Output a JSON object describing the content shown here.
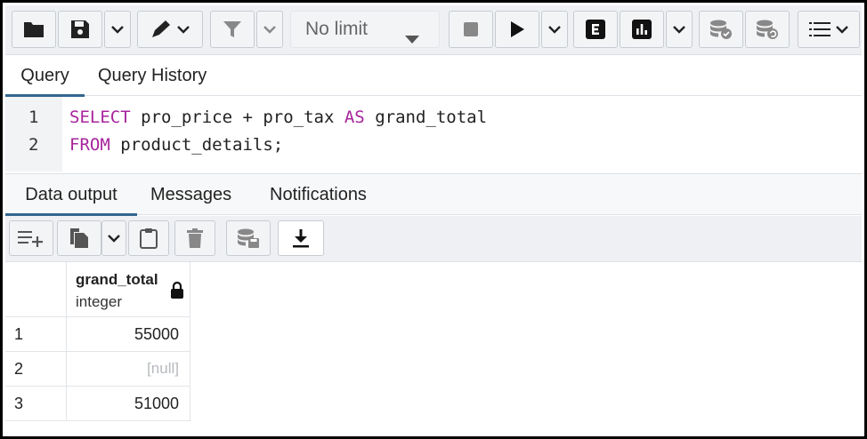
{
  "toolbar": {
    "open_file_icon": "folder-icon",
    "save_icon": "floppy-disk-icon",
    "edit_icon": "pencil-icon",
    "filter_icon": "funnel-icon",
    "limit_value": "No limit",
    "stop_icon": "stop-icon",
    "execute_icon": "play-icon",
    "explain_icon": "explain-e-icon",
    "explain_analyze_icon": "bar-chart-icon",
    "commit_icon": "database-check-icon",
    "rollback_icon": "database-rollback-icon",
    "macros_icon": "list-icon"
  },
  "query_tabs": [
    {
      "label": "Query",
      "active": true
    },
    {
      "label": "Query History",
      "active": false
    }
  ],
  "editor": {
    "lines": [
      {
        "number": "1",
        "keyword": "SELECT",
        "rest_a": " pro_price + pro_tax ",
        "keyword2": "AS",
        "rest_b": " grand_total"
      },
      {
        "number": "2",
        "keyword": "FROM",
        "rest_a": " product_details;",
        "keyword2": "",
        "rest_b": ""
      }
    ]
  },
  "output_tabs": [
    {
      "label": "Data output",
      "active": true
    },
    {
      "label": "Messages",
      "active": false
    },
    {
      "label": "Notifications",
      "active": false
    }
  ],
  "grid": {
    "column": {
      "name": "grand_total",
      "type": "integer"
    },
    "rows": [
      {
        "num": "1",
        "value": "55000",
        "is_null": false
      },
      {
        "num": "2",
        "value": "[null]",
        "is_null": true
      },
      {
        "num": "3",
        "value": "51000",
        "is_null": false
      }
    ]
  },
  "colors": {
    "accent": "#326690",
    "keyword": "#a7249c",
    "null_text": "#b5b9bd"
  }
}
